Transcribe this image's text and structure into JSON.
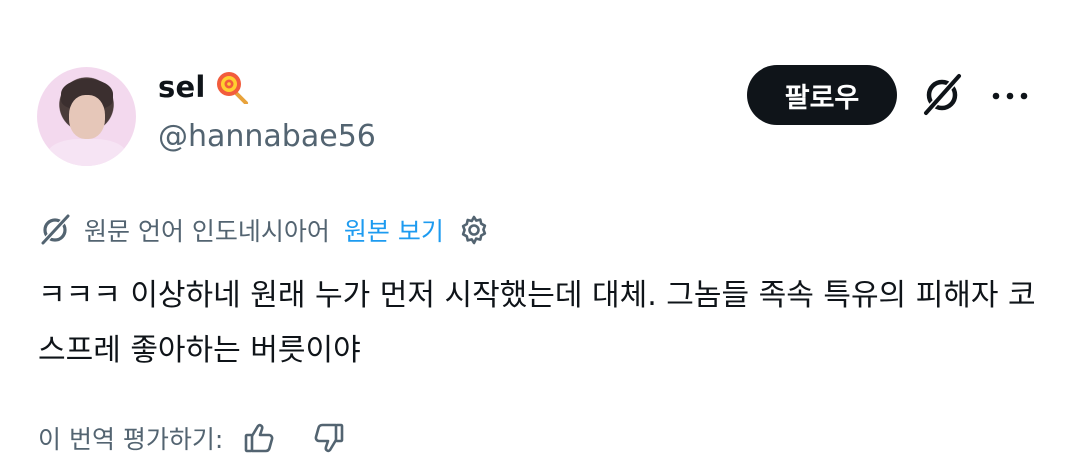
{
  "user": {
    "display_name": "sel",
    "emoji_icon": "lollipop-icon",
    "handle": "@hannabae56"
  },
  "actions": {
    "follow_label": "팔로우",
    "grok_icon": "grok-icon",
    "more_icon": "more-dots-icon"
  },
  "translation": {
    "source_language": "원문 언어 인도네시아어",
    "show_original_label": "원본 보기",
    "settings_icon": "gear-icon"
  },
  "tweet": {
    "text": "ㅋㅋㅋ 이상하네 원래 누가 먼저 시작했는데 대체. 그놈들 족속 특유의 피해자 코스프레 좋아하는 버릇이야"
  },
  "rating": {
    "prompt": "이 번역 평가하기:",
    "thumbs_up_icon": "thumbs-up-icon",
    "thumbs_down_icon": "thumbs-down-icon"
  },
  "colors": {
    "text": "#0f1419",
    "secondary": "#536471",
    "link": "#1d9bf0",
    "button_bg": "#0f1419"
  }
}
